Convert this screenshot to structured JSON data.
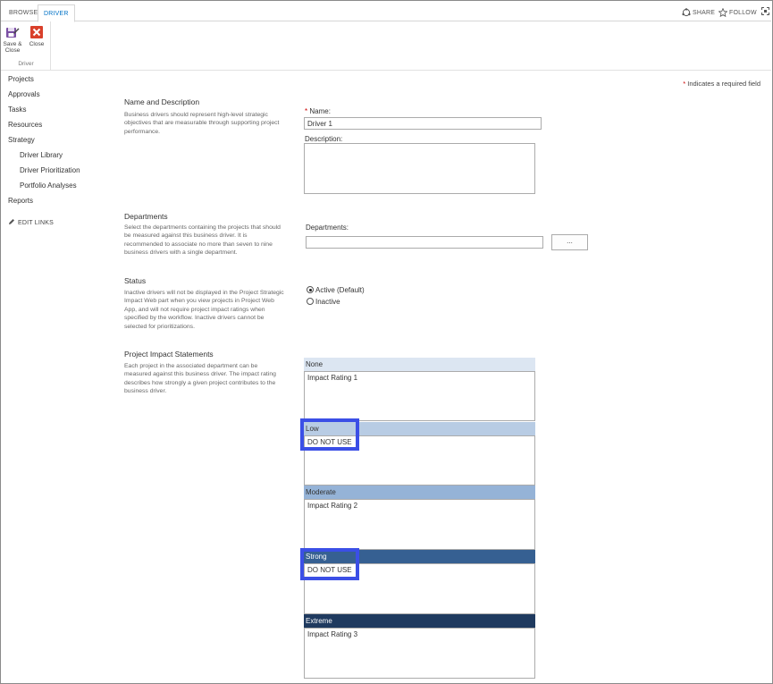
{
  "tabs": {
    "browse": "BROWSE",
    "driver": "DRIVER"
  },
  "top_actions": {
    "share": "SHARE",
    "follow": "FOLLOW"
  },
  "ribbon": {
    "save_close": "Save &",
    "save_close_2": "Close",
    "close": "Close",
    "group_label": "Driver"
  },
  "nav": {
    "items": [
      "Projects",
      "Approvals",
      "Tasks",
      "Resources",
      "Strategy"
    ],
    "sub_items": [
      "Driver Library",
      "Driver Prioritization",
      "Portfolio Analyses"
    ],
    "reports": "Reports",
    "edit_links": "EDIT LINKS"
  },
  "required_note": {
    "star": "*",
    "text": "Indicates a required field"
  },
  "name_section": {
    "title": "Name and Description",
    "description": "Business drivers should represent high-level strategic objectives that are measurable through supporting project performance.",
    "name_label": "Name:",
    "name_value": "Driver 1",
    "description_label": "Description:",
    "description_value": ""
  },
  "departments_section": {
    "title": "Departments",
    "description": "Select the departments containing the projects that should be measured against this business driver. It is recommended to associate no more than seven to nine business drivers with a single department.",
    "label": "Departments:",
    "value": "",
    "browse_button": "..."
  },
  "status_section": {
    "title": "Status",
    "description": "Inactive drivers will not be displayed in the Project Strategic Impact Web part when you view projects in Project Web App, and will not require project impact ratings when specified by the workflow. Inactive drivers cannot be selected for prioritizations.",
    "active_label": "Active (Default)",
    "inactive_label": "Inactive",
    "selected": "active"
  },
  "impact_section": {
    "title": "Project Impact Statements",
    "description": "Each project in the associated department can be measured against this business driver. The impact rating describes how strongly a given project contributes to the business driver.",
    "levels": [
      {
        "name": "None",
        "text": "Impact Rating 1",
        "color": "#dce6f2"
      },
      {
        "name": "Low",
        "text": "DO NOT USE",
        "color": "#b8cce4"
      },
      {
        "name": "Moderate",
        "text": "Impact Rating 2",
        "color": "#95b3d7"
      },
      {
        "name": "Strong",
        "text": "DO NOT USE",
        "color": "#366092"
      },
      {
        "name": "Extreme",
        "text": "Impact Rating 3",
        "color": "#1f3a5f"
      }
    ]
  },
  "colors": {
    "accent": "#0072c6",
    "highlight": "#3b4fe6",
    "required": "#cc0000"
  }
}
